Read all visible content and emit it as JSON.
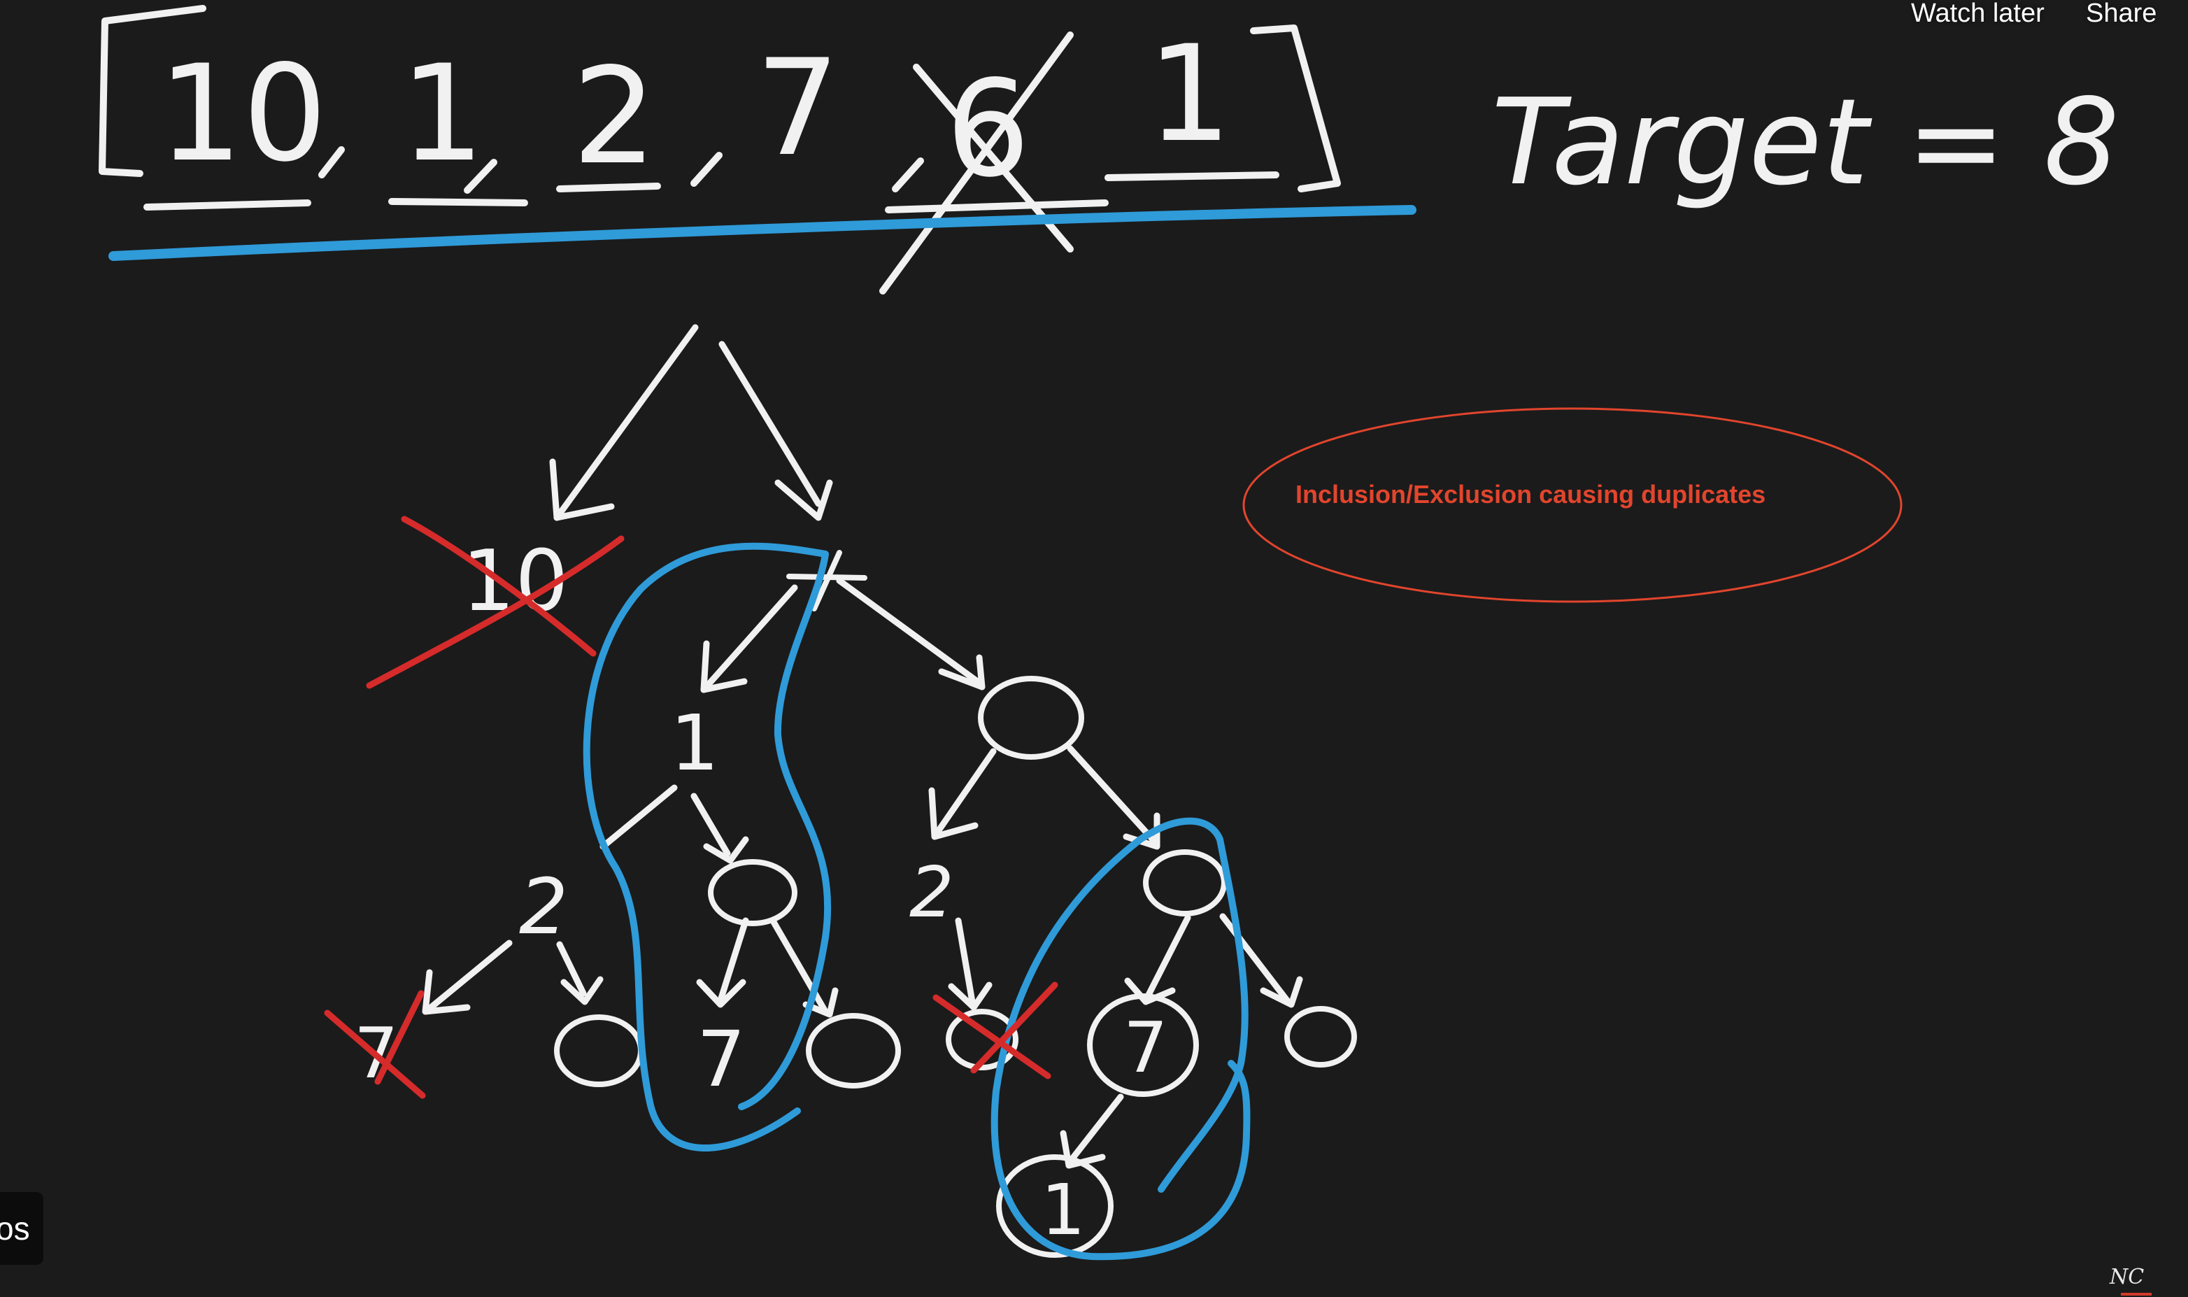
{
  "controls": {
    "watch_later": "Watch later",
    "share": "Share"
  },
  "side_chip": "os",
  "annotation": {
    "text": "Inclusion/Exclusion causing duplicates",
    "color": "#e2452d"
  },
  "whiteboard": {
    "array": [
      "10",
      "1",
      "2",
      "7",
      "6",
      "1"
    ],
    "target_label": "Target = 8",
    "tree_values": [
      "10",
      "1",
      "2",
      "7",
      "7",
      "7",
      "1"
    ]
  },
  "colors": {
    "background": "#1b1b1b",
    "chalk": "#f1f1f1",
    "blue": "#2f9bd9",
    "red": "#d62b2b"
  },
  "watermark": "NC"
}
